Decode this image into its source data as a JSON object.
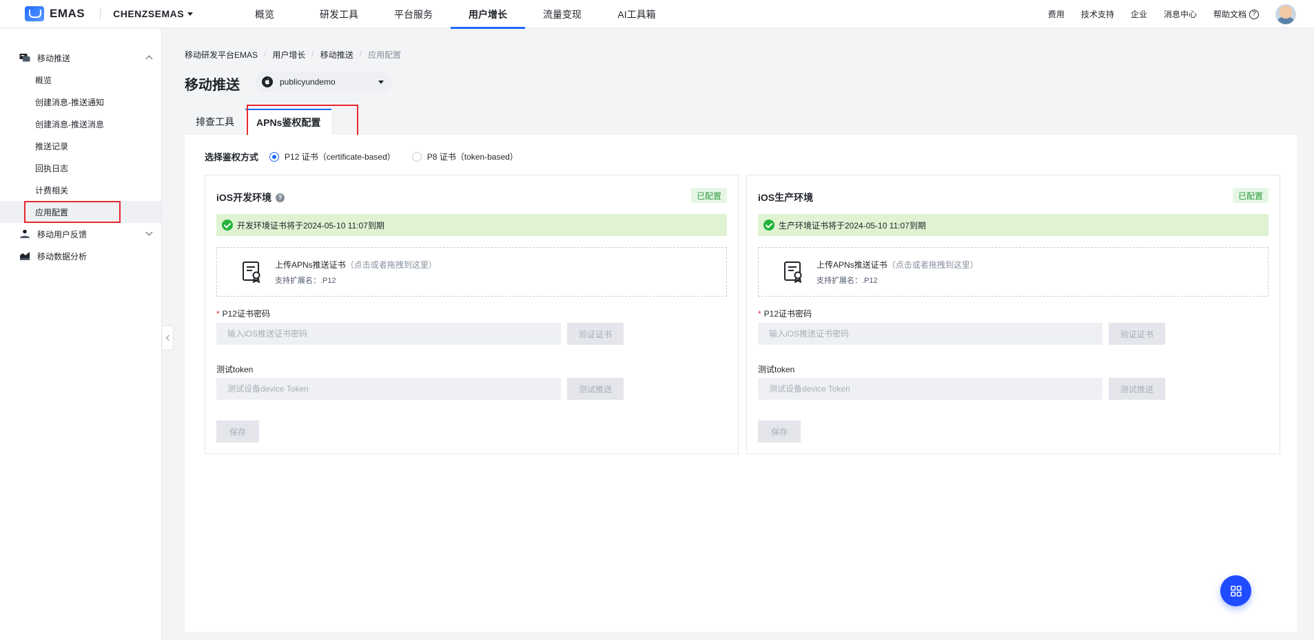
{
  "topbar": {
    "logo_text": "EMAS",
    "workspace": "CHENZSEMAS",
    "nav": [
      {
        "label": "概览"
      },
      {
        "label": "研发工具"
      },
      {
        "label": "平台服务"
      },
      {
        "label": "用户增长"
      },
      {
        "label": "流量变现"
      },
      {
        "label": "AI工具箱"
      }
    ],
    "active_nav": "用户增长",
    "links": {
      "fee": "费用",
      "support": "技术支持",
      "enterprise": "企业",
      "messages": "消息中心",
      "help": "帮助文档"
    },
    "help_icon_glyph": "?"
  },
  "sidebar": {
    "groups": [
      {
        "label": "移动推送",
        "icon": "push-icon",
        "expanded": true
      },
      {
        "label": "移动用户反馈",
        "icon": "feedback-icon",
        "expanded": false
      },
      {
        "label": "移动数据分析",
        "icon": "analytics-icon"
      }
    ],
    "push_items": [
      {
        "label": "概览"
      },
      {
        "label": "创建消息-推送通知"
      },
      {
        "label": "创建消息-推送消息"
      },
      {
        "label": "推送记录"
      },
      {
        "label": "回执日志"
      },
      {
        "label": "计费相关"
      },
      {
        "label": "应用配置"
      }
    ],
    "active_item": "应用配置"
  },
  "breadcrumb": [
    "移动研发平台EMAS",
    "用户增长",
    "移动推送",
    "应用配置"
  ],
  "breadcrumb_sep": "/",
  "page_title": "移动推送",
  "app_selector": {
    "value": "publicyundemo",
    "platform_icon": "apple-icon"
  },
  "tabs": [
    {
      "label": "排查工具"
    },
    {
      "label": "APNs鉴权配置"
    }
  ],
  "active_tab": "APNs鉴权配置",
  "auth": {
    "label": "选择鉴权方式",
    "options": [
      {
        "label": "P12 证书（certificate-based）",
        "checked": true
      },
      {
        "label": "P8 证书（token-based）",
        "checked": false
      }
    ]
  },
  "cards": [
    {
      "title": "iOS开发环境",
      "has_help": true,
      "help_glyph": "?",
      "badge": "已配置",
      "notice": "开发环境证书将于2024-05-10 11:07到期",
      "upload_title": "上传APNs推送证书",
      "upload_hint": "（点击或者拖拽到这里）",
      "upload_ext": "支持扩展名：.P12",
      "required_mark": "*",
      "pwd_label": "P12证书密码",
      "pwd_placeholder": "输入iOS推送证书密码",
      "verify_btn": "验证证书",
      "token_label": "测试token",
      "token_placeholder": "测试设备device Token",
      "test_btn": "测试推送",
      "save_btn": "保存"
    },
    {
      "title": "iOS生产环境",
      "has_help": false,
      "badge": "已配置",
      "notice": "生产环境证书将于2024-05-10 11:07到期",
      "upload_title": "上传APNs推送证书",
      "upload_hint": "（点击或者拖拽到这里）",
      "upload_ext": "支持扩展名：.P12",
      "required_mark": "*",
      "pwd_label": "P12证书密码",
      "pwd_placeholder": "输入iOS推送证书密码",
      "verify_btn": "验证证书",
      "token_label": "测试token",
      "token_placeholder": "测试设备device Token",
      "test_btn": "测试推送",
      "save_btn": "保存"
    }
  ],
  "colors": {
    "accent": "#1f6bff",
    "highlight_border": "#e8262d",
    "badge_text": "#2b9a3c",
    "notice_bg": "#dff3d2",
    "fab": "#1f4cff"
  },
  "fab_icon": "grid-icon"
}
